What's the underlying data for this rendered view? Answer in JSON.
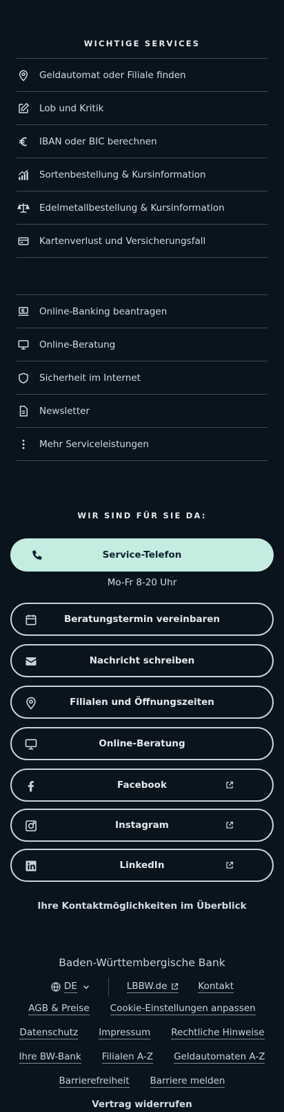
{
  "services": {
    "title": "WICHTIGE SERVICES",
    "group1": [
      {
        "icon": "map-pin-icon",
        "label": "Geldautomat oder Filiale finden"
      },
      {
        "icon": "edit-icon",
        "label": "Lob und Kritik"
      },
      {
        "icon": "euro-icon",
        "label": "IBAN oder BIC berechnen"
      },
      {
        "icon": "chart-icon",
        "label": "Sortenbestellung & Kursinformation"
      },
      {
        "icon": "scale-icon",
        "label": "Edelmetallbestellung & Kursinformation"
      },
      {
        "icon": "card-icon",
        "label": "Kartenverlust und Versicherungsfall"
      }
    ],
    "group2": [
      {
        "icon": "laptop-euro-icon",
        "label": "Online-Banking beantragen"
      },
      {
        "icon": "monitor-icon",
        "label": "Online-Beratung"
      },
      {
        "icon": "shield-icon",
        "label": "Sicherheit im Internet"
      },
      {
        "icon": "document-icon",
        "label": "Newsletter"
      },
      {
        "icon": "more-vertical-icon",
        "label": "Mehr Serviceleistungen"
      }
    ]
  },
  "contact": {
    "title": "WIR SIND FÜR SIE DA:",
    "phone_label": "Service-Telefon",
    "hours": "Mo-Fr 8-20 Uhr",
    "appointment": "Beratungstermin vereinbaren",
    "message": "Nachricht schreiben",
    "branches": "Filialen und Öffnungszeiten",
    "online": "Online-Beratung",
    "facebook": "Facebook",
    "instagram": "Instagram",
    "linkedin": "LinkedIn",
    "overview": "Ihre Kontaktmöglichkeiten im Überblick"
  },
  "footer": {
    "bank_name": "Baden-Württembergische Bank",
    "language": "DE",
    "lbbw": "LBBW.de",
    "kontakt": "Kontakt",
    "agb": "AGB & Preise",
    "cookies": "Cookie-Einstellungen anpassen",
    "datenschutz": "Datenschutz",
    "impressum": "Impressum",
    "rechtliches": "Rechtliche Hinweise",
    "bwbank": "Ihre BW-Bank",
    "filialen": "Filialen A-Z",
    "geldautomaten": "Geldautomaten A-Z",
    "barrierefreiheit": "Barrierefreiheit",
    "barriere_melden": "Barriere melden",
    "revoke": "Vertrag widerrufen"
  },
  "colors": {
    "background": "#0a141c",
    "primary_button": "#c4ece0",
    "divider": "#3b4c5b"
  }
}
